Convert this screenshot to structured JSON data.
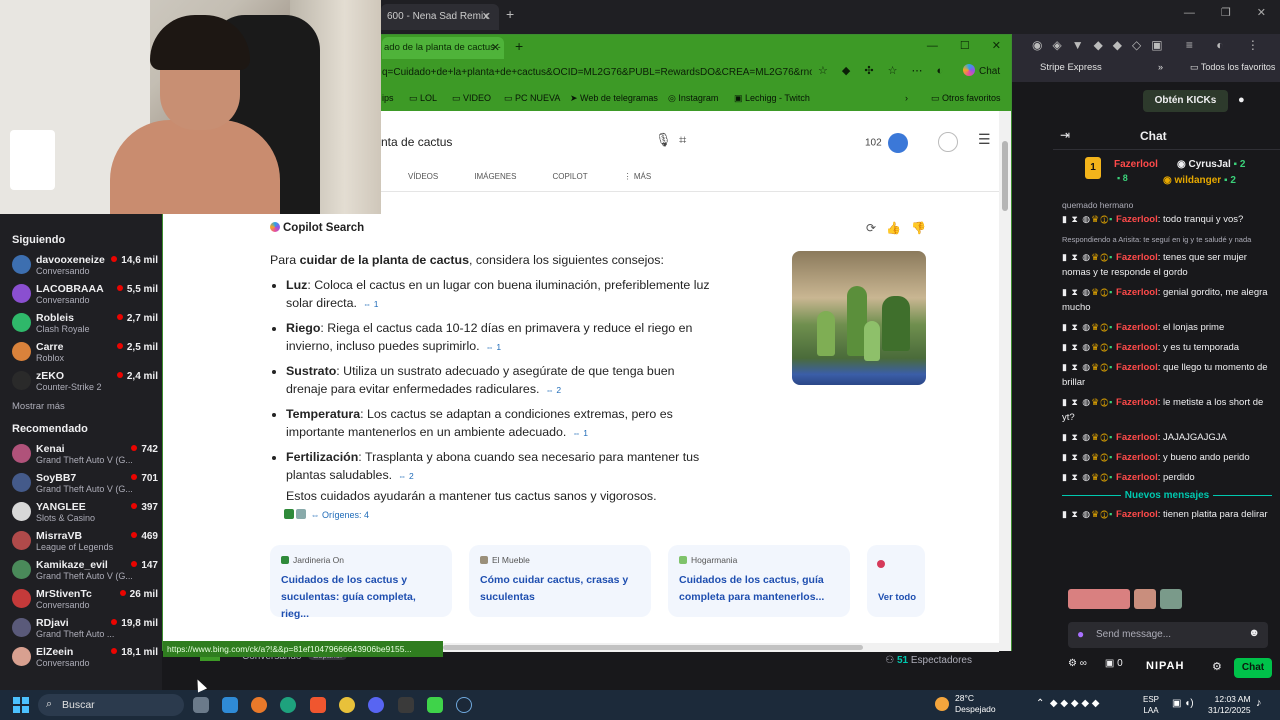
{
  "bg_browser": {
    "tab_title": "600 - Nena Sad Remix",
    "bookmark_stripe": "Stripe Express",
    "bookmark_all": "Todos los favoritos"
  },
  "edge": {
    "tab_title": "ado de la planta de cactus - B",
    "url": "q=Cuidado+de+la+planta+de+cactus&OCID=ML2G76&PUBL=RewardsDO&CREA=ML2G76&rnorewa...",
    "chat_label": "Chat",
    "bookmarks": [
      "ips",
      "LOL",
      "VIDEO",
      "PC NUEVA",
      "Web de telegramas",
      "Instagram",
      "Lechigg - Twitch"
    ],
    "bookmarks_other": "Otros favoritos",
    "status_url": "https://www.bing.com/ck/a?!&&p=81ef10479666643906be9155..."
  },
  "search": {
    "query": "nta de cactus",
    "rewards_points": "102",
    "tabs": [
      "VÍDEOS",
      "IMÁGENES",
      "COPILOT",
      "⋮ MÁS"
    ]
  },
  "copilot": {
    "title": "Copilot Search",
    "intro_prefix": "Para ",
    "intro_bold": "cuidar de la planta de cactus",
    "intro_suffix": ", considera los siguientes consejos:",
    "tips": [
      {
        "term": "Luz",
        "text": ": Coloca el cactus en un lugar con buena iluminación, preferiblemente luz solar directa.",
        "cite": "⇔ 1"
      },
      {
        "term": "Riego",
        "text": ": Riega el cactus cada 10-12 días en primavera y reduce el riego en invierno, incluso puedes suprimirlo.",
        "cite": "⇔ 1"
      },
      {
        "term": "Sustrato",
        "text": ": Utiliza un sustrato adecuado y asegúrate de que tenga buen drenaje para evitar enfermedades radiculares.",
        "cite": "⇔ 2"
      },
      {
        "term": "Temperatura",
        "text": ": Los cactus se adaptan a condiciones extremas, pero es importante mantenerlos en un ambiente adecuado.",
        "cite": "⇔ 1"
      },
      {
        "term": "Fertilización",
        "text": ": Trasplanta y abona cuando sea necesario para mantener tus plantas saludables.",
        "cite": "⇔ 2"
      }
    ],
    "outro": "Estos cuidados ayudarán a mantener tus cactus sanos y vigorosos.",
    "origins": "⇔ Orígenes: 4",
    "cards": [
      {
        "source": "Jardineria On",
        "title": "Cuidados de los cactus y suculentas: guía completa, rieg...",
        "color": "#2f8a3a"
      },
      {
        "source": "El Mueble",
        "title": "Cómo cuidar cactus, crasas y suculentas",
        "color": "#9a8f7a"
      },
      {
        "source": "Hogarmania",
        "title": "Cuidados de los cactus, guía completa para mantenerlos...",
        "color": "#7fc36b"
      }
    ],
    "see_all": "Ver todo"
  },
  "twitch_sidebar": {
    "following_title": "Siguiendo",
    "following": [
      {
        "name": "davooxeneize",
        "game": "Conversando",
        "viewers": "14,6 mil",
        "color": "#3d6fb0"
      },
      {
        "name": "LACOBRAAA",
        "game": "Conversando",
        "viewers": "5,5 mil",
        "color": "#8a4fd0"
      },
      {
        "name": "Robleis",
        "game": "Clash Royale",
        "viewers": "2,7 mil",
        "color": "#2fb86a"
      },
      {
        "name": "Carre",
        "game": "Roblox",
        "viewers": "2,5 mil",
        "color": "#d9823b"
      },
      {
        "name": "zEKO",
        "game": "Counter-Strike 2",
        "viewers": "2,4 mil",
        "color": "#2a2a2a"
      }
    ],
    "show_more": "Mostrar más",
    "recommended_title": "Recomendado",
    "recommended": [
      {
        "name": "Kenai",
        "game": "Grand Theft Auto V (G...",
        "viewers": "742",
        "color": "#b0527a"
      },
      {
        "name": "SoyBB7",
        "game": "Grand Theft Auto V (G...",
        "viewers": "701",
        "color": "#445a8a"
      },
      {
        "name": "YANGLEE",
        "game": "Slots & Casino",
        "viewers": "397",
        "color": "#d8d8d8"
      },
      {
        "name": "MisrraVB",
        "game": "League of Legends",
        "viewers": "469",
        "color": "#b04a4a"
      },
      {
        "name": "Kamikaze_evil",
        "game": "Grand Theft Auto V (G...",
        "viewers": "147",
        "color": "#4a8a5a"
      },
      {
        "name": "MrStivenTc",
        "game": "Conversando",
        "viewers": "26 mil",
        "color": "#c43a3a"
      },
      {
        "name": "RDjavi",
        "game": "Grand Theft Auto ...",
        "viewers": "19,8 mil",
        "color": "#5a5a7a"
      },
      {
        "name": "ElZeein",
        "game": "Conversando",
        "viewers": "18,1 mil",
        "color": "#d8a090"
      }
    ]
  },
  "stream_footer": {
    "category": "Conversando",
    "tag": "Español",
    "viewers": "51",
    "viewers_label": "Espectadores"
  },
  "chat": {
    "kick_button": "Obtén KICKs",
    "title": "Chat",
    "top_gifter": "Fazerlool",
    "top_gifter_count": "8",
    "gifters": [
      {
        "name": "CyrusJal",
        "count": "2"
      },
      {
        "name": "wildanger",
        "count": "2"
      }
    ],
    "first_line": "quemado hermano",
    "messages": [
      {
        "user": "Fazerlool",
        "text": ": todo tranqui y vos?"
      },
      {
        "reply": "Respondiendo a Arisita: te seguí en ig y te saludé y nada",
        "user": "Fazerlool",
        "text": ": tenes que ser mujer nomas y te responde el gordo"
      },
      {
        "user": "Fazerlool",
        "text": ": genial gordito, me alegra mucho"
      },
      {
        "user": "Fazerlool",
        "text": ": el lonjas prime"
      },
      {
        "user": "Fazerlool",
        "text": ": y es tu temporada"
      },
      {
        "user": "Fazerlool",
        "text": ": que llego tu momento de brillar"
      },
      {
        "user": "Fazerlool",
        "text": ": le metiste a los short de yt?"
      },
      {
        "user": "Fazerlool",
        "text": ": JAJAJGAJGJA"
      },
      {
        "user": "Fazerlool",
        "text": ": y bueno ando perido"
      },
      {
        "user": "Fazerlool",
        "text": ": perdido"
      }
    ],
    "new_messages": "Nuevos mensajes",
    "after_new": {
      "user": "Fazerlool",
      "text": ": tienen platita para delirar"
    },
    "input_placeholder": "Send message...",
    "points": "0",
    "extension": "NIPAH",
    "send_label": "Chat"
  },
  "taskbar": {
    "search": "Buscar",
    "weather_temp": "28°C",
    "weather_desc": "Despejado",
    "lang": "ESP",
    "lang_sub": "LAA",
    "time": "12:03 AM",
    "date": "31/12/2025"
  }
}
